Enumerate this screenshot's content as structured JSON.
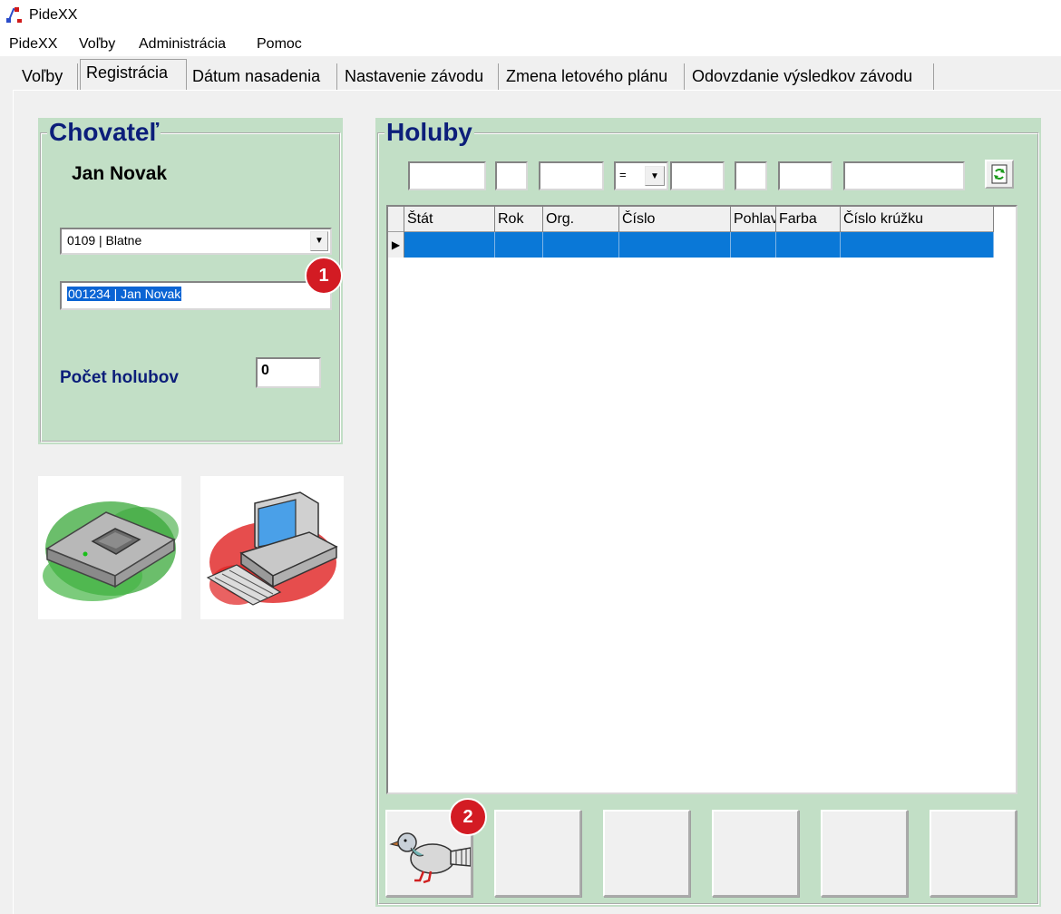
{
  "window": {
    "title": "PideXX"
  },
  "menu": [
    "PideXX",
    "Voľby",
    "Administrácia",
    "Pomoc"
  ],
  "tabs": [
    {
      "label": "Voľby"
    },
    {
      "label": "Registrácia",
      "active": true
    },
    {
      "label": "Dátum nasadenia"
    },
    {
      "label": "Nastavenie závodu"
    },
    {
      "label": "Zmena letového plánu"
    },
    {
      "label": "Odovzdanie výsledkov závodu"
    }
  ],
  "breeder": {
    "title": "Chovateľ",
    "name": "Jan Novak",
    "club_select": "0109 | Blatne",
    "breeder_select": "001234 | Jan Novak",
    "count_label": "Počet holubov",
    "count_value": "0"
  },
  "pigeons": {
    "title": "Holuby",
    "operator_value": "=",
    "columns": [
      "Štát",
      "Rok",
      "Org.",
      "Číslo",
      "Pohlavie",
      "Farba",
      "Číslo krúžku"
    ]
  },
  "badges": [
    "1",
    "2"
  ],
  "icons": {
    "app": "pidexx-app-icon",
    "device": "pigeon-clock-device-icon",
    "computer": "computer-icon",
    "refresh": "refresh-icon",
    "pigeon": "pigeon-icon"
  },
  "colors": {
    "panel_bg": "#c2dfc6",
    "title_color": "#0c1e7a",
    "selection": "#0a78d7",
    "badge": "#d31b23"
  }
}
